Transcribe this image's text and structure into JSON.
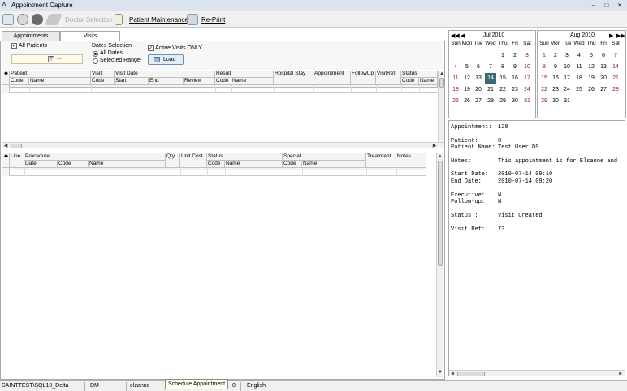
{
  "window": {
    "title": "Appointment Capture"
  },
  "toolbar": {
    "doctor_selection": "Doctor Selection",
    "patient_maintenance": "Patient Maintenance",
    "reprint": "Re-Print"
  },
  "tabs": [
    {
      "label": "Appointments"
    },
    {
      "label": "Visits"
    }
  ],
  "filters": {
    "all_patients_label": "All Patients",
    "all_patients_checked": true,
    "dates_selection_label": "Dates Selection",
    "all_dates_label": "All Dates",
    "selected_range_label": "Selected Range",
    "active_visits_label": "Active Visits ONLY",
    "active_visits_checked": true,
    "load_label": "Load",
    "patient_lookup_btn": "?",
    "patient_lookup_ellipsis": "..."
  },
  "visits_grid": {
    "group_headers": [
      "Patient",
      "Visit",
      "Visit Date",
      "Result",
      "Hospital Stay",
      "Appointment",
      "FollowUp",
      "VisitRef",
      "Status"
    ],
    "sub_headers": [
      "Code",
      "Name",
      "Code",
      "Start",
      "End",
      "Review",
      "Code",
      "Name",
      "Code",
      "Name"
    ]
  },
  "lines_grid": {
    "group_headers": [
      "Line",
      "Procedure",
      "Qty",
      "Unit Cost",
      "Status",
      "Special",
      "Treatment",
      "Notes"
    ],
    "sub_headers": [
      "Date",
      "Code",
      "Name",
      "Code",
      "Name",
      "Code",
      "Name"
    ]
  },
  "calendars": [
    {
      "month": "Jul 2010",
      "days": [
        "Sun",
        "Mon",
        "Tue",
        "Wed",
        "Thu",
        "Fri",
        "Sat"
      ],
      "weeks": [
        [
          "",
          "",
          "",
          "",
          "1",
          "2",
          "3"
        ],
        [
          "4",
          "5",
          "6",
          "7",
          "8",
          "9",
          "10"
        ],
        [
          "11",
          "12",
          "13",
          "14",
          "15",
          "16",
          "17"
        ],
        [
          "18",
          "19",
          "20",
          "21",
          "22",
          "23",
          "24"
        ],
        [
          "25",
          "26",
          "27",
          "28",
          "29",
          "30",
          "31"
        ]
      ],
      "selected": "14"
    },
    {
      "month": "Aug 2010",
      "days": [
        "Sun",
        "Mon",
        "Tue",
        "Wed",
        "Thu",
        "Fri",
        "Sat"
      ],
      "weeks": [
        [
          "1",
          "2",
          "3",
          "4",
          "5",
          "6",
          "7"
        ],
        [
          "8",
          "9",
          "10",
          "11",
          "12",
          "13",
          "14"
        ],
        [
          "15",
          "16",
          "17",
          "18",
          "19",
          "20",
          "21"
        ],
        [
          "22",
          "23",
          "24",
          "25",
          "26",
          "27",
          "28"
        ],
        [
          "29",
          "30",
          "31",
          "",
          "",
          "",
          ""
        ]
      ],
      "selected": ""
    }
  ],
  "info": {
    "appointment_label": "Appointment:",
    "appointment_value": "128",
    "patient_label": "Patient:",
    "patient_value": "8",
    "patient_name_label": "Patient Name:",
    "patient_name_value": "Test User DS",
    "notes_label": "Notes:",
    "notes_value": "This appointment is for Elsanne and",
    "start_label": "Start Date:",
    "start_value": "2010-07-14 09:10",
    "end_label": "End   Date:",
    "end_value": "2010-07-14 09:20",
    "executive_label": "Executive:",
    "executive_value": "N",
    "followup_label": "Follow-up:",
    "followup_value": "N",
    "status_label": "Status    :",
    "status_value": "Visit Created",
    "visitref_label": "Visit Ref:",
    "visitref_value": "73"
  },
  "statusbar": {
    "server": "SAINTTEST\\SQL10_Delta",
    "mode": "DM",
    "user": "elzanne",
    "count": "0",
    "language": "English"
  },
  "tooltip": {
    "text": "Schedule Appointment"
  },
  "colors": {
    "selected_day": "#3a6b74",
    "weekend_red": "#8b2020",
    "titlebar": "#dbe4ee"
  }
}
